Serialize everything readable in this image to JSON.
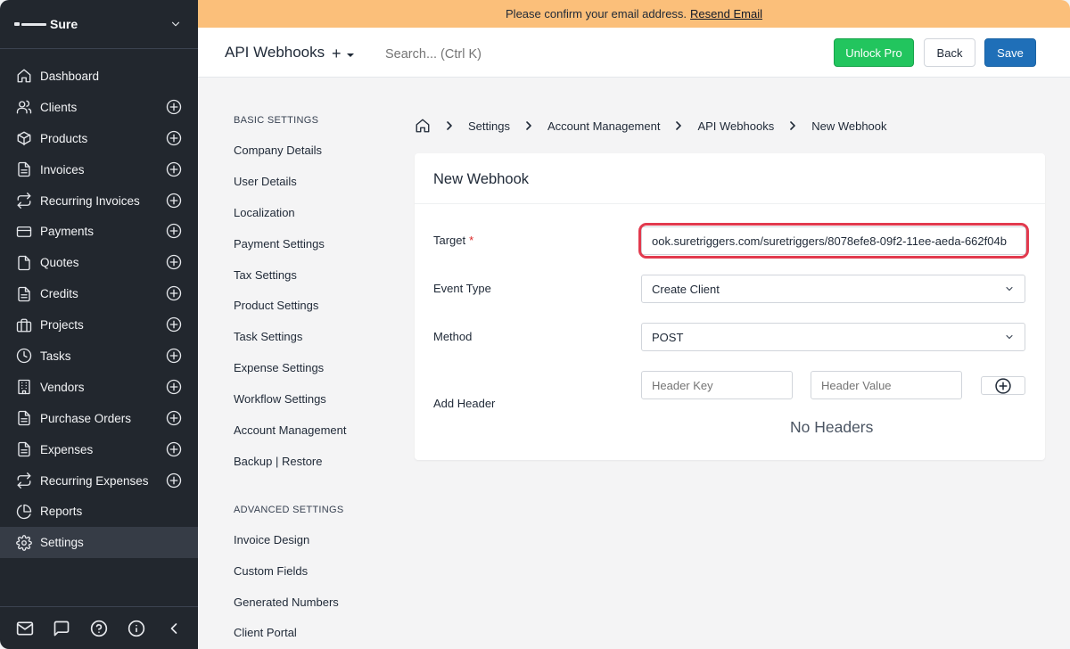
{
  "sidebar": {
    "company": "Sure",
    "items": [
      {
        "label": "Dashboard",
        "icon": "home-icon",
        "plus": false
      },
      {
        "label": "Clients",
        "icon": "users-icon",
        "plus": true
      },
      {
        "label": "Products",
        "icon": "package-icon",
        "plus": true
      },
      {
        "label": "Invoices",
        "icon": "file-text-icon",
        "plus": true
      },
      {
        "label": "Recurring Invoices",
        "icon": "repeat-icon",
        "plus": true
      },
      {
        "label": "Payments",
        "icon": "credit-card-icon",
        "plus": true
      },
      {
        "label": "Quotes",
        "icon": "file-icon",
        "plus": true
      },
      {
        "label": "Credits",
        "icon": "file-text-icon",
        "plus": true
      },
      {
        "label": "Projects",
        "icon": "briefcase-icon",
        "plus": true
      },
      {
        "label": "Tasks",
        "icon": "clock-icon",
        "plus": true
      },
      {
        "label": "Vendors",
        "icon": "building-icon",
        "plus": true
      },
      {
        "label": "Purchase Orders",
        "icon": "file-text-icon",
        "plus": true
      },
      {
        "label": "Expenses",
        "icon": "file-text-icon",
        "plus": true
      },
      {
        "label": "Recurring Expenses",
        "icon": "repeat-icon",
        "plus": true
      },
      {
        "label": "Reports",
        "icon": "pie-chart-icon",
        "plus": false
      },
      {
        "label": "Settings",
        "icon": "gear-icon",
        "plus": false,
        "active": true
      }
    ],
    "footer_icons": [
      "mail-icon",
      "message-icon",
      "help-circle-icon",
      "info-icon",
      "chevron-left-icon"
    ]
  },
  "banner": {
    "text": "Please confirm your email address.",
    "link": "Resend Email"
  },
  "topbar": {
    "title": "API Webhooks",
    "add_label": "+",
    "search_placeholder": "Search... (Ctrl K)",
    "unlock_label": "Unlock Pro",
    "back_label": "Back",
    "save_label": "Save"
  },
  "settings_menu": {
    "basic_heading": "BASIC SETTINGS",
    "basic": [
      "Company Details",
      "User Details",
      "Localization",
      "Payment Settings",
      "Tax Settings",
      "Product Settings",
      "Task Settings",
      "Expense Settings",
      "Workflow Settings",
      "Account Management",
      "Backup | Restore"
    ],
    "advanced_heading": "ADVANCED SETTINGS",
    "advanced": [
      "Invoice Design",
      "Custom Fields",
      "Generated Numbers",
      "Client Portal"
    ]
  },
  "breadcrumb": [
    "Settings",
    "Account Management",
    "API Webhooks",
    "New Webhook"
  ],
  "form": {
    "title": "New Webhook",
    "target_label": "Target",
    "required_mark": "*",
    "target_value": "ook.suretriggers.com/suretriggers/8078efe8-09f2-11ee-aeda-662f04b",
    "event_type_label": "Event Type",
    "event_type_value": "Create Client",
    "method_label": "Method",
    "method_value": "POST",
    "add_header_label": "Add Header",
    "header_key_placeholder": "Header Key",
    "header_value_placeholder": "Header Value",
    "no_headers": "No Headers"
  },
  "colors": {
    "sidebar_bg": "#22272e",
    "banner_bg": "#fbbf7a",
    "unlock_pro": "#22c55e",
    "save": "#1f6fb8",
    "highlight": "#e23a4e"
  }
}
